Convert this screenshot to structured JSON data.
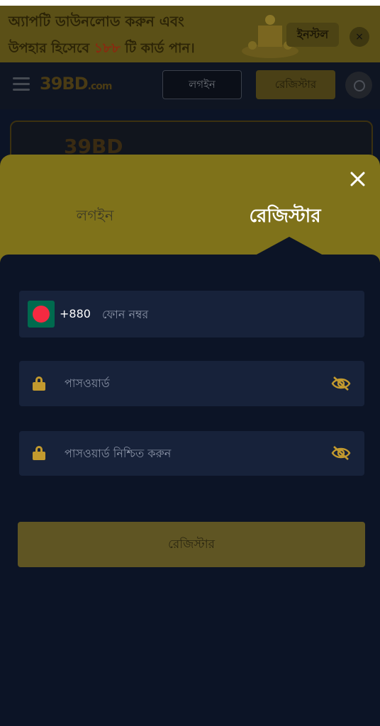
{
  "promo": {
    "line1": "অ্যাপটি ডাউনলোড করুন এবং",
    "line2_before": "উপহার হিসেবে",
    "line2_highlight": "১৮৮",
    "line2_after": "টি কার্ড পান।",
    "install_label": "ইনস্টল",
    "close_symbol": "×"
  },
  "header": {
    "logo_main": "39BD",
    "logo_suffix": ".com",
    "login_label": "লগইন",
    "register_label": "রেজিস্টার"
  },
  "hero": {
    "logo_text": "39BD"
  },
  "modal": {
    "tabs": {
      "login": "লগইন",
      "register": "রেজিস্টার"
    },
    "phone": {
      "country_code": "+880",
      "placeholder": "ফোন নম্বর"
    },
    "password": {
      "placeholder": "পাসওয়ার্ড"
    },
    "confirm_password": {
      "placeholder": "পাসওয়ার্ড নিশ্চিত করুন"
    },
    "submit_label": "রেজিস্টার"
  },
  "icons": {
    "menu": "menu-icon",
    "support": "headset-icon",
    "close": "close-icon",
    "lock": "lock-icon",
    "eye": "eye-off-icon",
    "flag": "bangladesh-flag-icon"
  },
  "colors": {
    "accent_gold": "#c39a2e",
    "modal_header": "#7f721a",
    "background": "#0c1426",
    "field_bg": "#17223a"
  }
}
